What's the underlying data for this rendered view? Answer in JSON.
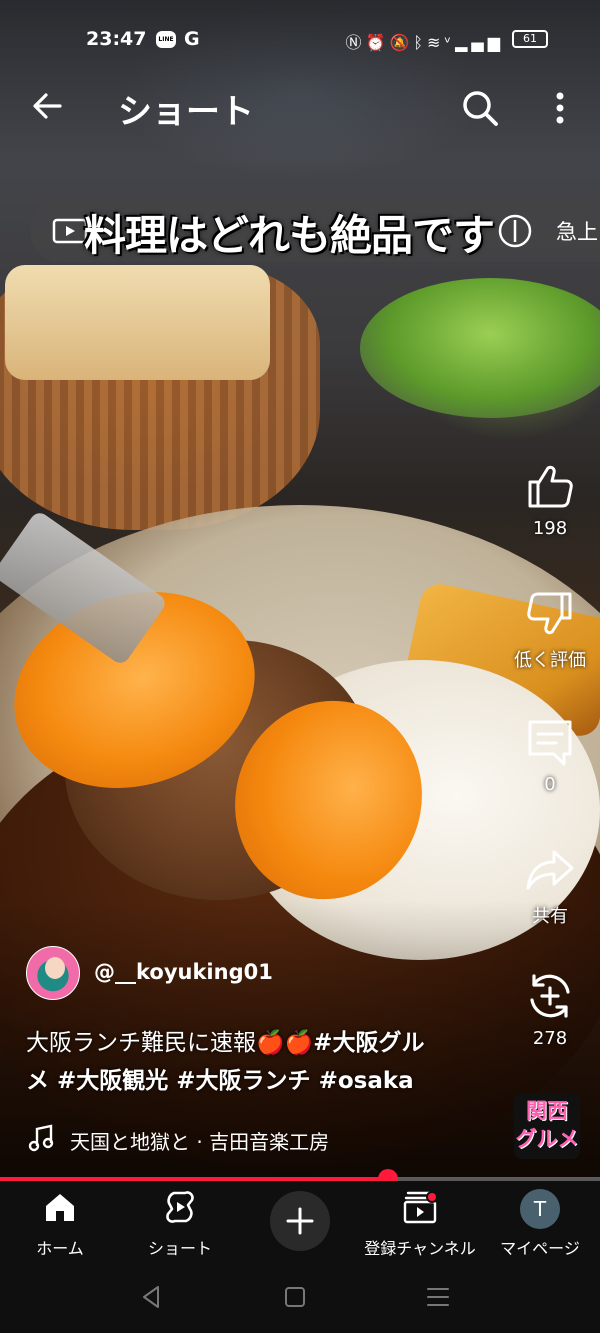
{
  "status_bar": {
    "time": "23:47",
    "line_badge": "LINE",
    "google_glyph": "G",
    "battery": "61",
    "icons": [
      "nfc-icon",
      "alarm-icon",
      "mute-icon",
      "bluetooth-icon",
      "wifi-icon",
      "volte-icon",
      "signal-icon"
    ]
  },
  "header": {
    "title": "ショート",
    "icons": [
      "back-arrow-icon",
      "search-icon",
      "more-vert-icon"
    ]
  },
  "video_overlay": {
    "caption": "料理はどれも絶品です",
    "right_hint": "急上"
  },
  "actions": {
    "like_count": "198",
    "dislike_label": "低く評価",
    "comment_count": "0",
    "share_label": "共有",
    "remix_count": "278"
  },
  "channel": {
    "handle": "@__koyuking01"
  },
  "description": {
    "line1_plain": "大阪ランチ難民に速報🍎🍎",
    "line1_tag": "#大阪グル",
    "line2": "メ #大阪観光 #大阪ランチ #osaka"
  },
  "music": {
    "track": "天国と地獄と · 吉田音楽工房"
  },
  "badge": {
    "line1": "関西",
    "line2": "グルメ"
  },
  "playback": {
    "progress": 0.647
  },
  "bottom_nav": {
    "home": "ホーム",
    "shorts": "ショート",
    "subscriptions": "登録チャンネル",
    "you": "マイページ",
    "avatar_letter": "T"
  },
  "colors": {
    "accent": "#ff1a3c",
    "nav_bg": "#0f0f0f"
  }
}
